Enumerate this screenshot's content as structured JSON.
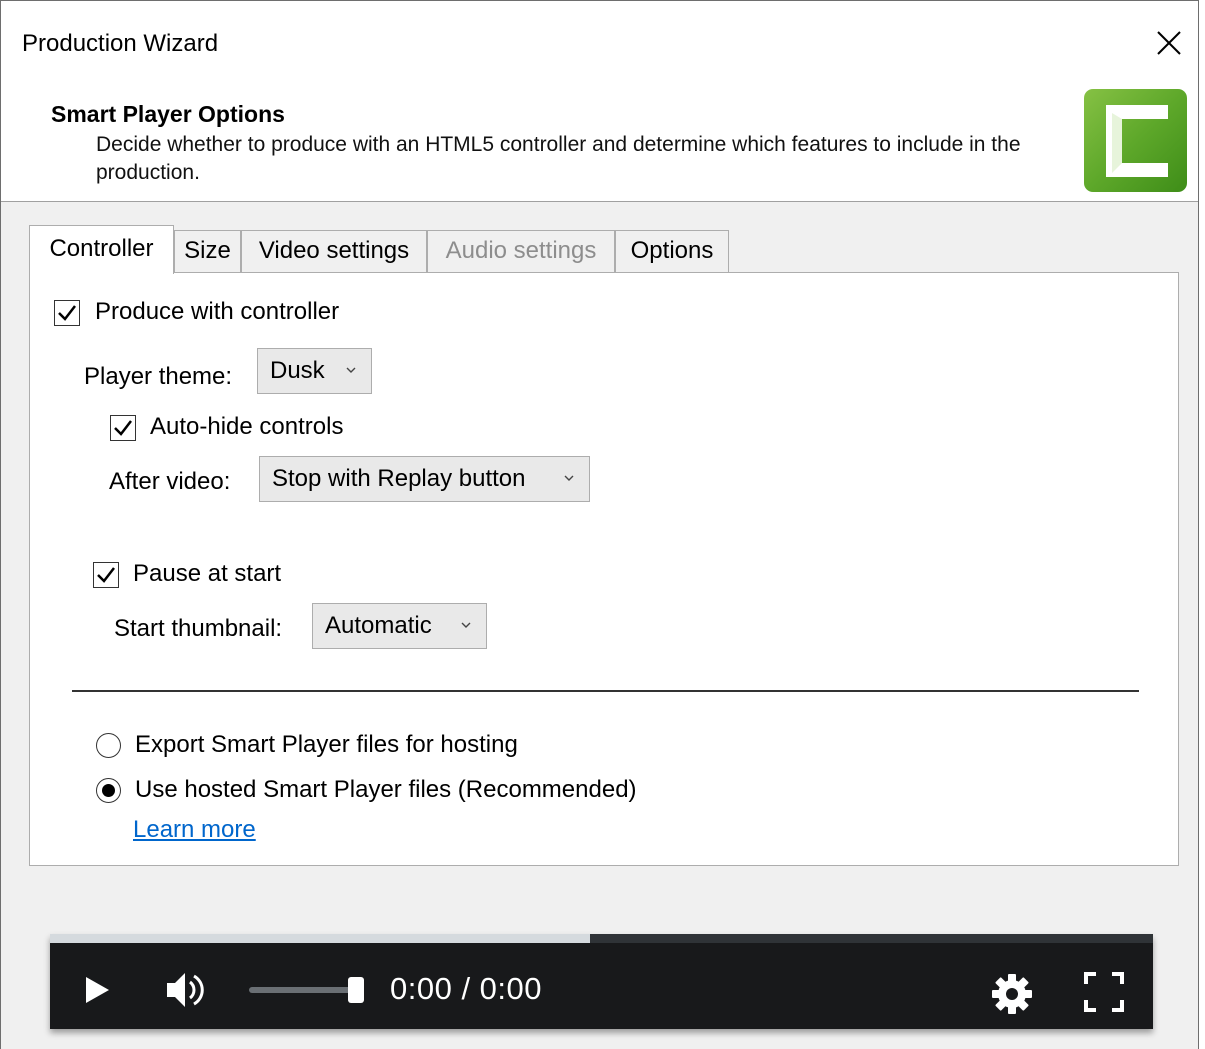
{
  "window": {
    "title": "Production Wizard"
  },
  "header": {
    "title": "Smart Player Options",
    "description": "Decide whether to produce with an HTML5 controller and determine which features to include in the production."
  },
  "tabs": [
    {
      "label": "Controller",
      "active": true,
      "enabled": true
    },
    {
      "label": "Size",
      "active": false,
      "enabled": true
    },
    {
      "label": "Video settings",
      "active": false,
      "enabled": true
    },
    {
      "label": "Audio settings",
      "active": false,
      "enabled": false
    },
    {
      "label": "Options",
      "active": false,
      "enabled": true
    }
  ],
  "controller": {
    "produce_with_controller": {
      "label": "Produce with controller",
      "checked": true
    },
    "player_theme": {
      "label": "Player theme:",
      "value": "Dusk"
    },
    "auto_hide": {
      "label": "Auto-hide controls",
      "checked": true
    },
    "after_video": {
      "label": "After video:",
      "value": "Stop with Replay button"
    },
    "pause_at_start": {
      "label": "Pause at start",
      "checked": true
    },
    "start_thumbnail": {
      "label": "Start thumbnail:",
      "value": "Automatic"
    },
    "hosting": {
      "options": [
        {
          "label": "Export Smart Player files for hosting",
          "selected": false
        },
        {
          "label": "Use hosted Smart Player files (Recommended)",
          "selected": true
        }
      ],
      "learn_more": "Learn more"
    }
  },
  "preview_player": {
    "time": "0:00 / 0:00",
    "progress_fraction": 0.49,
    "volume_fraction": 1.0
  },
  "colors": {
    "logo_green": "#5ea82a",
    "link": "#0066cc",
    "player_bg": "#18191b"
  }
}
